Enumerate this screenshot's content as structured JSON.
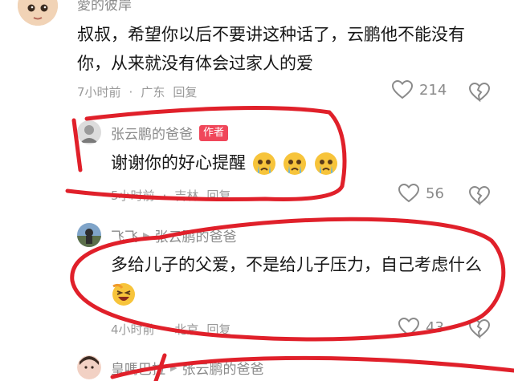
{
  "comments": [
    {
      "username": "愛的彼岸",
      "text": "叔叔，希望你以后不要讲这种话了，云鹏他不能没有你，从来就没有体会过家人的爱",
      "time": "7小时前",
      "location": "广东",
      "reply": "回复",
      "likes": "214"
    },
    {
      "username": "张云鹏的爸爸",
      "badge": "作者",
      "text": "谢谢你的好心提醒",
      "time": "5小时前",
      "location": "吉林",
      "reply": "回复",
      "likes": "56"
    },
    {
      "username": "飞飞",
      "reply_to": "张云鹏的爸爸",
      "text": "多给儿子的父爱，不是给儿子压力，自己考虑什么",
      "time": "4小时前",
      "location": "北京",
      "reply": "回复",
      "likes": "43"
    },
    {
      "username": "皇嗎巴拉",
      "reply_to": "张云鹏的爸爸"
    }
  ],
  "colors": {
    "annotation_red": "#e0202a",
    "author_badge": "#f0475a"
  },
  "icons": [
    "heart-icon",
    "broken-heart-icon",
    "reply-arrow-icon",
    "crying-emoji",
    "laughing-emoji"
  ]
}
